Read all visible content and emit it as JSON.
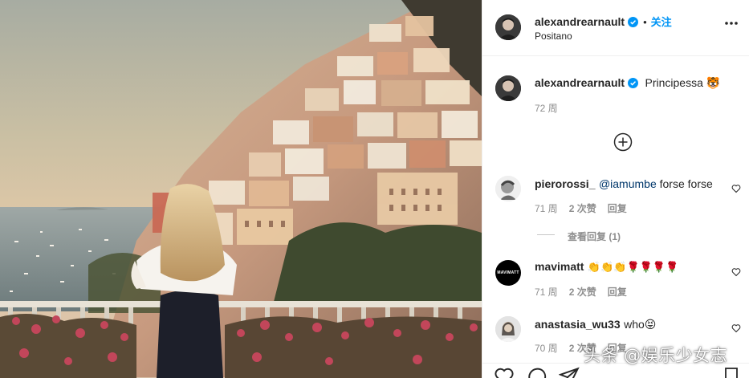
{
  "post": {
    "author": "alexandrearnault",
    "follow_label": "关注",
    "location": "Positano"
  },
  "caption": {
    "author": "alexandrearnault",
    "text": "Principessa 🐯",
    "time": "72 周"
  },
  "comments": [
    {
      "author": "pierorossi_",
      "mention": "@iamumbe",
      "text": " forse forse",
      "time": "71 周",
      "likes": "2 次赞",
      "reply_label": "回复",
      "view_replies": "查看回复 (1)"
    },
    {
      "author": "mavimatt",
      "avatar_text": "MAVIMATT",
      "text": "👏👏👏🌹🌹🌹🌹",
      "time": "71 周",
      "likes": "2 次赞",
      "reply_label": "回复"
    },
    {
      "author": "anastasia_wu33",
      "text": "who😝",
      "time": "70 周",
      "likes": "2 次赞",
      "reply_label": "回复"
    }
  ],
  "watermark": "头条 @娱乐少女志",
  "colors": {
    "accent": "#0095f6",
    "mention": "#00376b",
    "meta": "#8e8e8e"
  },
  "icons": [
    "verified-badge-icon",
    "more-options-icon",
    "add-comment-icon",
    "heart-icon",
    "comment-icon",
    "share-icon"
  ]
}
